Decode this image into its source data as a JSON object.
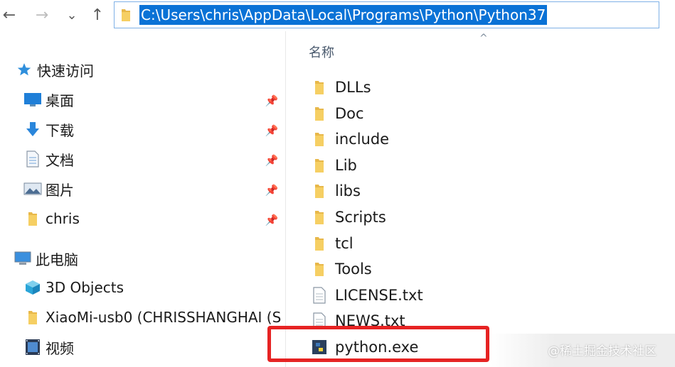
{
  "navigation": {
    "back_icon": "arrow-left-icon",
    "forward_icon": "arrow-right-icon",
    "recent_icon": "chevron-down-icon",
    "up_icon": "arrow-up-icon",
    "back_glyph": "←",
    "forward_glyph": "→",
    "recent_glyph": "⌄",
    "up_glyph": "↑"
  },
  "address_bar": {
    "path": "C:\\Users\\chris\\AppData\\Local\\Programs\\Python\\Python37",
    "selected": true,
    "selection_color": "#0a72d6"
  },
  "sidebar": {
    "quick_access_label": "快速访问",
    "pinned_items": [
      {
        "label": "桌面",
        "icon": "desktop-icon"
      },
      {
        "label": "下载",
        "icon": "download-icon"
      },
      {
        "label": "文档",
        "icon": "document-icon"
      },
      {
        "label": "图片",
        "icon": "pictures-icon"
      },
      {
        "label": "chris",
        "icon": "folder-icon"
      }
    ],
    "pin_icon": "pin-icon",
    "this_pc_label": "此电脑",
    "pc_items": [
      {
        "label": "3D Objects",
        "icon": "3d-objects-icon"
      },
      {
        "label": "XiaoMi-usb0 (CHRISSHANGHAI (S",
        "icon": "network-drive-icon"
      },
      {
        "label": "视频",
        "icon": "videos-icon"
      }
    ]
  },
  "file_list": {
    "column_header": "名称",
    "sort_glyph": "^",
    "items": [
      {
        "name": "DLLs",
        "type": "folder"
      },
      {
        "name": "Doc",
        "type": "folder"
      },
      {
        "name": "include",
        "type": "folder"
      },
      {
        "name": "Lib",
        "type": "folder"
      },
      {
        "name": "libs",
        "type": "folder"
      },
      {
        "name": "Scripts",
        "type": "folder"
      },
      {
        "name": "tcl",
        "type": "folder"
      },
      {
        "name": "Tools",
        "type": "folder"
      },
      {
        "name": "LICENSE.txt",
        "type": "text-file"
      },
      {
        "name": "NEWS.txt",
        "type": "text-file"
      },
      {
        "name": "python.exe",
        "type": "python-exe"
      }
    ],
    "highlighted_item": "python.exe",
    "highlight_color": "#e62323"
  },
  "watermark": {
    "text": "@稀土掘金技术社区"
  }
}
